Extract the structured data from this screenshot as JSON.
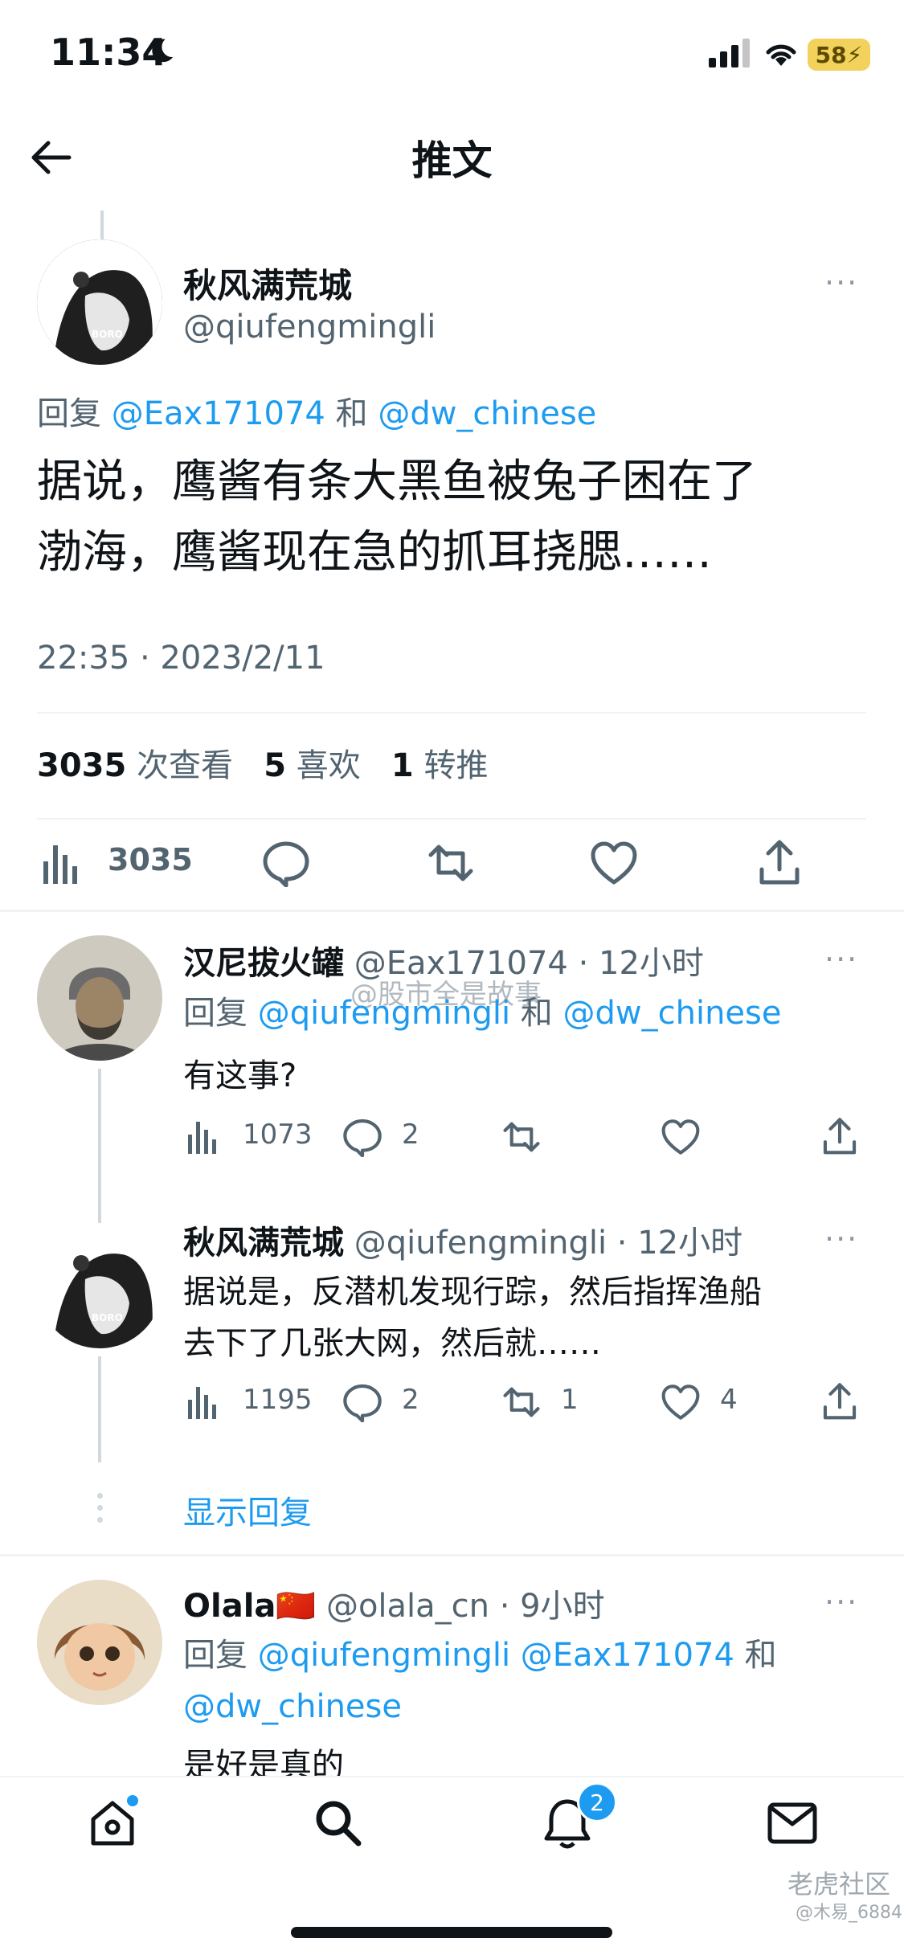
{
  "status_bar": {
    "time": "11:34",
    "battery": "58"
  },
  "header": {
    "title": "推文"
  },
  "main_tweet": {
    "name": "秋风满荒城",
    "handle": "@qiufengmingli",
    "reply_prefix": "回复",
    "reply_users": [
      "@Eax171074",
      "@dw_chinese"
    ],
    "reply_and": "和",
    "text_line1": "据说，鹰酱有条大黑鱼被兔子困在了",
    "text_line2": "渤海，鹰酱现在急的抓耳挠腮……",
    "timestamp": "22:35 · 2023/2/11",
    "views_count": "3035",
    "views_label": "次查看",
    "likes_count": "5",
    "likes_label": "喜欢",
    "retweets_count": "1",
    "retweets_label": "转推",
    "analytics_count": "3035"
  },
  "replies": [
    {
      "name": "汉尼拔火罐",
      "handle": "@Eax171074",
      "time": "· 12小时",
      "reply_prefix": "回复",
      "reply_user1": "@qiufengmingli",
      "reply_and": "和",
      "reply_user2": "@dw_chinese",
      "text": "有这事?",
      "views": "1073",
      "comments": "2",
      "retweets": "",
      "likes": ""
    },
    {
      "name": "秋风满荒城",
      "handle": "@qiufengmingli",
      "time": "· 12小时",
      "text_line1": "据说是，反潜机发现行踪，然后指挥渔船",
      "text_line2": "去下了几张大网，然后就……",
      "views": "1195",
      "comments": "2",
      "retweets": "1",
      "likes": "4"
    },
    {
      "name": "Olala",
      "flag": "🇨🇳",
      "handle": "@olala_cn",
      "time": "· 9小时",
      "reply_prefix": "回复",
      "reply_user1": "@qiufengmingli",
      "reply_user2": "@Eax171074",
      "reply_and": "和",
      "reply_user3": "@dw_chinese",
      "text_partial": "是好是真的"
    }
  ],
  "show_replies": "显示回复",
  "watermark": "@股市全是故事",
  "watermark_corner": "老虎社区",
  "watermark_sub": "@木易_6884",
  "bottom_nav": {
    "notifications_badge": "2"
  }
}
